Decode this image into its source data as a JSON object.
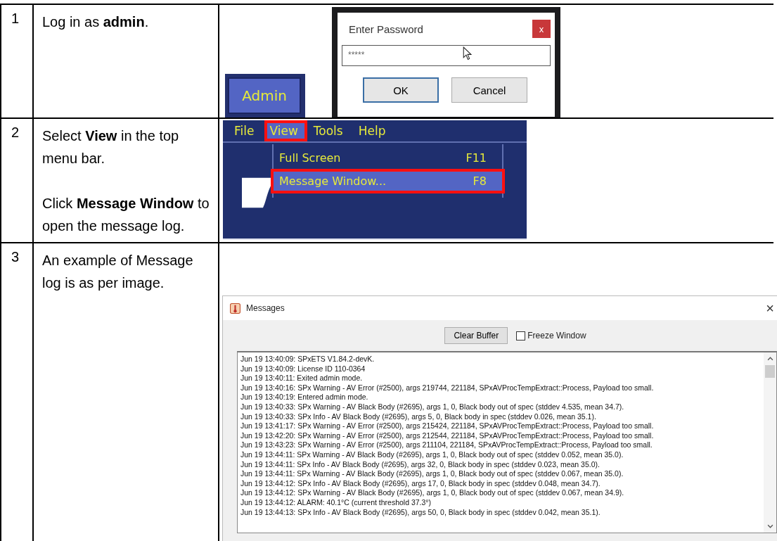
{
  "steps": [
    {
      "number": "1",
      "paragraphs": [
        "Log in as **admin**."
      ],
      "screenshot": {
        "kind": "login",
        "admin_button": "Admin",
        "dialog": {
          "title": "Enter Password",
          "close": "x",
          "password": "*****",
          "buttons": [
            "OK",
            "Cancel"
          ]
        }
      }
    },
    {
      "number": "2",
      "paragraphs": [
        "Select **View** in the top menu bar.",
        "Click **Message Window** to open the message log."
      ],
      "screenshot": {
        "kind": "menu",
        "menu_bar": [
          {
            "label": "File",
            "selected": false
          },
          {
            "label": "View",
            "selected": true
          },
          {
            "label": "Tools",
            "selected": false
          },
          {
            "label": "Help",
            "selected": false
          }
        ],
        "dropdown": [
          {
            "label": "Full Screen",
            "shortcut": "F11",
            "selected": false
          },
          {
            "label": "Message Window...",
            "shortcut": "F8",
            "selected": true
          }
        ]
      }
    },
    {
      "number": "3",
      "paragraphs": [
        "An example of Message log is as per image."
      ],
      "screenshot": {
        "kind": "messages",
        "title": "Messages",
        "close": "×",
        "clear_button": "Clear Buffer",
        "freeze": {
          "label": "Freeze Window",
          "checked": false
        },
        "log": [
          "Jun 19 13:40:09: SPxETS V1.84.2-devK.",
          "Jun 19 13:40:09: License ID 110-0364",
          "Jun 19 13:40:11: Exited admin mode.",
          "Jun 19 13:40:16: SPx Warning - AV Error (#2500), args 219744, 221184, SPxAVProcTempExtract::Process, Payload too small.",
          "Jun 19 13:40:19: Entered admin mode.",
          "Jun 19 13:40:33: SPx Warning - AV Black Body (#2695), args 1, 0, Black body out of spec (stddev 4.535, mean 34.7).",
          "Jun 19 13:40:33: SPx Info - AV Black Body (#2695), args 5, 0, Black body in spec (stddev 0.026, mean 35.1).",
          "Jun 19 13:41:17: SPx Warning - AV Error (#2500), args 215424, 221184, SPxAVProcTempExtract::Process, Payload too small.",
          "Jun 19 13:42:20: SPx Warning - AV Error (#2500), args 212544, 221184, SPxAVProcTempExtract::Process, Payload too small.",
          "Jun 19 13:43:23: SPx Warning - AV Error (#2500), args 211104, 221184, SPxAVProcTempExtract::Process, Payload too small.",
          "Jun 19 13:44:11: SPx Warning - AV Black Body (#2695), args 1, 0, Black body out of spec (stddev 0.052, mean 35.0).",
          "Jun 19 13:44:11: SPx Info - AV Black Body (#2695), args 32, 0, Black body in spec (stddev 0.023, mean 35.0).",
          "Jun 19 13:44:11: SPx Warning - AV Black Body (#2695), args 1, 0, Black body out of spec (stddev 0.067, mean 35.0).",
          "Jun 19 13:44:12: SPx Info - AV Black Body (#2695), args 17, 0, Black body in spec (stddev 0.048, mean 34.7).",
          "Jun 19 13:44:12: SPx Warning - AV Black Body (#2695), args 1, 0, Black body out of spec (stddev 0.067, mean 34.9).",
          "Jun 19 13:44:12: ALARM: 40.1°C (current threshold 37.3°)",
          "Jun 19 13:44:13: SPx Info - AV Black Body (#2695), args 50, 0, Black body in spec (stddev 0.042, mean 35.1)."
        ]
      }
    }
  ]
}
